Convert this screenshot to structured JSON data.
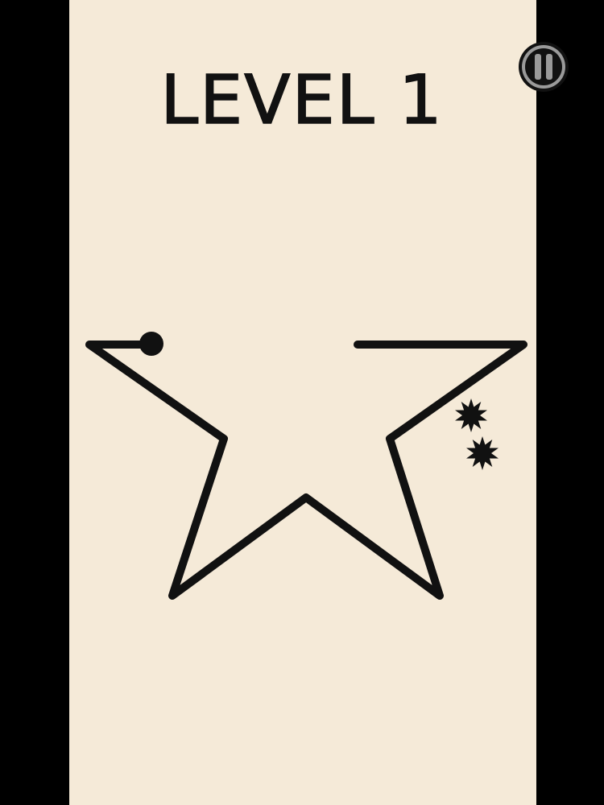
{
  "hud": {
    "level_label": "LEVEL 1",
    "pause_icon": "pause-icon"
  },
  "colors": {
    "background": "#f5ead8",
    "side_bars": "#000000",
    "ink": "#111111",
    "pause_ring": "#9a9a9a"
  },
  "game": {
    "path_shape": "star-outline-with-gap",
    "player": "ball",
    "hazards": [
      "spiked-mine",
      "spiked-mine"
    ]
  }
}
